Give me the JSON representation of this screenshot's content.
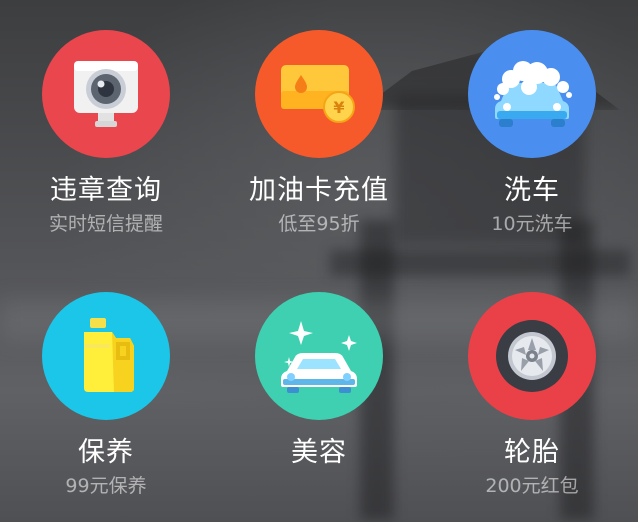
{
  "services": [
    {
      "label": "违章查询",
      "sub": "实时短信提醒",
      "icon": "camera-icon",
      "color": "#e9464d"
    },
    {
      "label": "加油卡充值",
      "sub": "低至95折",
      "icon": "fuel-card-icon",
      "color": "#f65a2b"
    },
    {
      "label": "洗车",
      "sub": "10元洗车",
      "icon": "car-wash-icon",
      "color": "#4a8ff0"
    },
    {
      "label": "保养",
      "sub": "99元保养",
      "icon": "oil-bottle-icon",
      "color": "#1bc6e8"
    },
    {
      "label": "美容",
      "sub": "",
      "icon": "sparkle-car-icon",
      "color": "#3ed0b0"
    },
    {
      "label": "轮胎",
      "sub": "200元红包",
      "icon": "tire-icon",
      "color": "#ea4149"
    }
  ]
}
